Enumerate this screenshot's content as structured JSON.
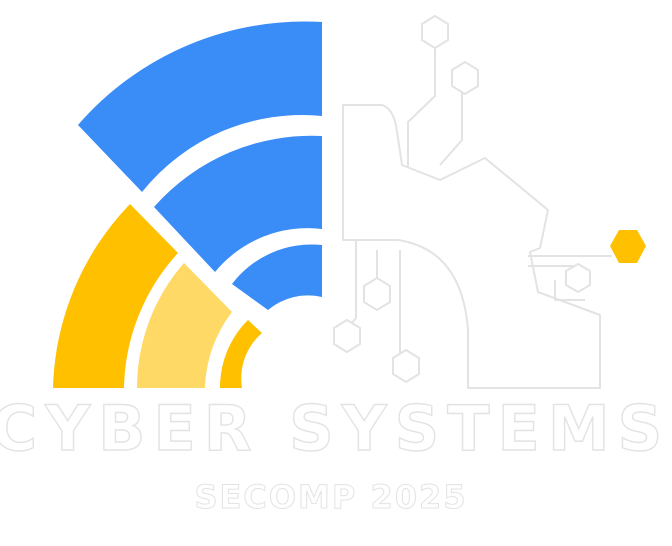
{
  "logo": {
    "title": "CYBER SYSTEMS",
    "subtitle": "SECOMP 2025"
  },
  "colors": {
    "blue": "#3a8cf7",
    "yellow": "#ffc000",
    "light_yellow": "#ffd966",
    "node_orange": "#ffc000",
    "white": "#ffffff",
    "outline": "#e3e3e3"
  }
}
